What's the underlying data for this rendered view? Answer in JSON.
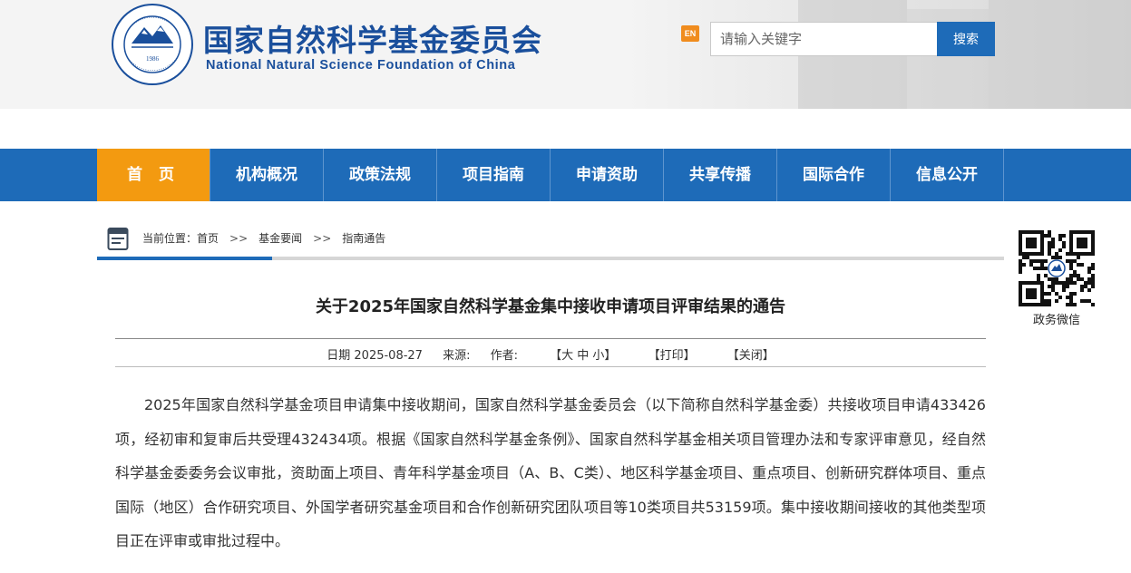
{
  "header": {
    "title_cn": "国家自然科学基金委员会",
    "title_en": "National Natural Science Foundation of China",
    "logo_year": "1986",
    "en_label": "EN",
    "search_placeholder": "请输入关键字",
    "search_button": "搜索"
  },
  "nav": {
    "items": [
      {
        "label": "首 页"
      },
      {
        "label": "机构概况"
      },
      {
        "label": "政策法规"
      },
      {
        "label": "项目指南"
      },
      {
        "label": "申请资助"
      },
      {
        "label": "共享传播"
      },
      {
        "label": "国际合作"
      },
      {
        "label": "信息公开"
      }
    ]
  },
  "breadcrumb": {
    "prefix": "当前位置：",
    "items": [
      "首页",
      "基金要闻",
      "指南通告"
    ],
    "separator": ">>"
  },
  "qr": {
    "label": "政务微信"
  },
  "article": {
    "title": "关于2025年国家自然科学基金集中接收申请项目评审结果的通告",
    "date_label": "日期",
    "date": "2025-08-27",
    "source_label": "来源:",
    "author_label": "作者:",
    "font_size_tool": "【大 中 小】",
    "print_tool": "【打印】",
    "close_tool": "【关闭】",
    "paragraph": "2025年国家自然科学基金项目申请集中接收期间，国家自然科学基金委员会（以下简称自然科学基金委）共接收项目申请433426项，经初审和复审后共受理432434项。根据《国家自然科学基金条例》、国家自然科学基金相关项目管理办法和专家评审意见，经自然科学基金委委务会议审批，资助面上项目、青年科学基金项目（A、B、C类）、地区科学基金项目、重点项目、创新研究群体项目、重点国际（地区）合作研究项目、外国学者研究基金项目和合作创新研究团队项目等10类项目共53159项。集中接收期间接收的其他类型项目正在评审或审批过程中。"
  },
  "colors": {
    "brand_blue": "#1e6bb8",
    "active_orange": "#f39a10",
    "title_blue": "#1a4f9c"
  }
}
